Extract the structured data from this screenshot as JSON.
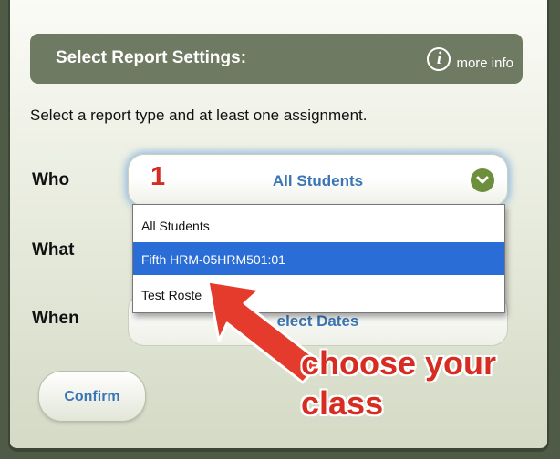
{
  "header": {
    "title": "Select Report Settings:",
    "more_info": "more info"
  },
  "instructions": "Select a report type and at least one assignment.",
  "labels": {
    "who": "Who",
    "what": "What",
    "when": "When"
  },
  "who_select": {
    "value": "All Students",
    "options": [
      "All Students",
      "Fifth HRM-05HRM501:01",
      "Test Roste"
    ]
  },
  "when_select": {
    "label": "elect Dates"
  },
  "confirm_label": "Confirm",
  "annotation": {
    "step": "1",
    "line1": "choose your",
    "line2": "class",
    "color": "#d62c22"
  },
  "colors": {
    "header_bg": "#6f7a63",
    "link_blue": "#3a75b5",
    "selection": "#2b6dd6"
  }
}
